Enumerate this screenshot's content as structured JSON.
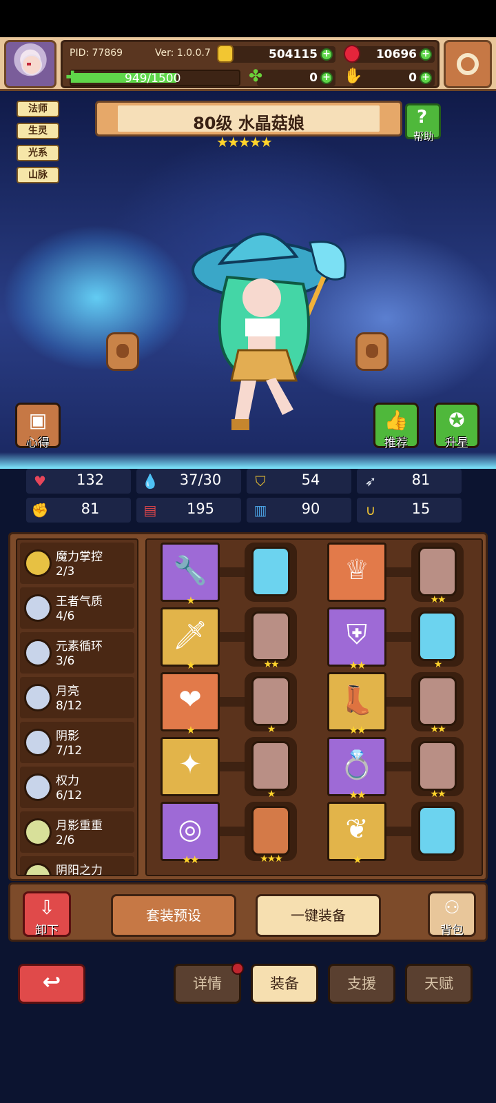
{
  "header": {
    "pid": "PID: 77869",
    "version": "Ver: 1.0.0.7",
    "gold": "504115",
    "rubies": "10696",
    "clovers": "0",
    "hands": "0",
    "stamina": "949/1500",
    "stamina_fraction": 0.63
  },
  "hero": {
    "title": "80级 水晶菇娘",
    "stars": "★★★★★",
    "star_count": 5,
    "tags": [
      "法师",
      "生灵",
      "光系",
      "山脉"
    ],
    "help_label": "帮助",
    "notes_label": "心得",
    "recommend_label": "推荐",
    "upgrade_label": "升星"
  },
  "stats": [
    {
      "icon": "heart-icon",
      "value": "132",
      "color": "#e6465a"
    },
    {
      "icon": "mana-drop-icon",
      "value": "37/30",
      "color": "#6cd3ef"
    },
    {
      "icon": "shield-icon",
      "value": "54",
      "color": "#f2c632"
    },
    {
      "icon": "wing-icon",
      "value": "81",
      "color": "#e8eef6"
    },
    {
      "icon": "fist-icon",
      "value": "81",
      "color": "#e07a6a"
    },
    {
      "icon": "book-icon",
      "value": "195",
      "color": "#d8454a"
    },
    {
      "icon": "scroll-icon",
      "value": "90",
      "color": "#4aa0e0"
    },
    {
      "icon": "horseshoe-icon",
      "value": "15",
      "color": "#f2c632"
    }
  ],
  "sets": [
    {
      "name": "魔力掌控",
      "count": "2/3",
      "color": "#e7c143"
    },
    {
      "name": "王者气质",
      "count": "4/6",
      "color": "#c8d4ea"
    },
    {
      "name": "元素循环",
      "count": "3/6",
      "color": "#c8d4ea"
    },
    {
      "name": "月亮",
      "count": "8/12",
      "color": "#c8d4ea"
    },
    {
      "name": "阴影",
      "count": "7/12",
      "color": "#c8d4ea"
    },
    {
      "name": "权力",
      "count": "6/12",
      "color": "#c8d4ea"
    },
    {
      "name": "月影重重",
      "count": "2/6",
      "color": "#d8e09a"
    },
    {
      "name": "阴阳之力",
      "count": "",
      "color": "#d8e09a"
    }
  ],
  "equipment_left": [
    {
      "item": "wrench-staff-icon",
      "bg": "#9e6ad6",
      "stars": "★",
      "gem": "blue",
      "gem_stars": ""
    },
    {
      "item": "sword-icon",
      "bg": "#e2b44a",
      "stars": "★",
      "gem": "tan",
      "gem_stars": "★★"
    },
    {
      "item": "necklace-icon",
      "bg": "#e27a4a",
      "stars": "★",
      "gem": "tan",
      "gem_stars": "★"
    },
    {
      "item": "brooch-icon",
      "bg": "#e2b44a",
      "stars": "",
      "gem": "tan",
      "gem_stars": "★"
    },
    {
      "item": "ring-icon",
      "bg": "#9e6ad6",
      "stars": "★★",
      "gem": "copper",
      "gem_stars": "★★★"
    }
  ],
  "equipment_right": [
    {
      "item": "crown-icon",
      "bg": "#e27a4a",
      "stars": "",
      "gem": "tan",
      "gem_stars": "★★"
    },
    {
      "item": "armor-icon",
      "bg": "#9e6ad6",
      "stars": "★★",
      "gem": "blue",
      "gem_stars": "★"
    },
    {
      "item": "boots-icon",
      "bg": "#e2b44a",
      "stars": "★★",
      "gem": "tan",
      "gem_stars": "★★"
    },
    {
      "item": "diamond-ring-icon",
      "bg": "#9e6ad6",
      "stars": "★★",
      "gem": "tan",
      "gem_stars": "★★"
    },
    {
      "item": "cape-icon",
      "bg": "#e2b44a",
      "stars": "★",
      "gem": "blue",
      "gem_stars": ""
    }
  ],
  "actions": {
    "unequip_label": "卸下",
    "preset_label": "套装预设",
    "auto_equip_label": "一键装备",
    "bag_label": "背包"
  },
  "nav": {
    "tabs": [
      "详情",
      "装备",
      "支援",
      "天赋"
    ],
    "active": "装备"
  }
}
